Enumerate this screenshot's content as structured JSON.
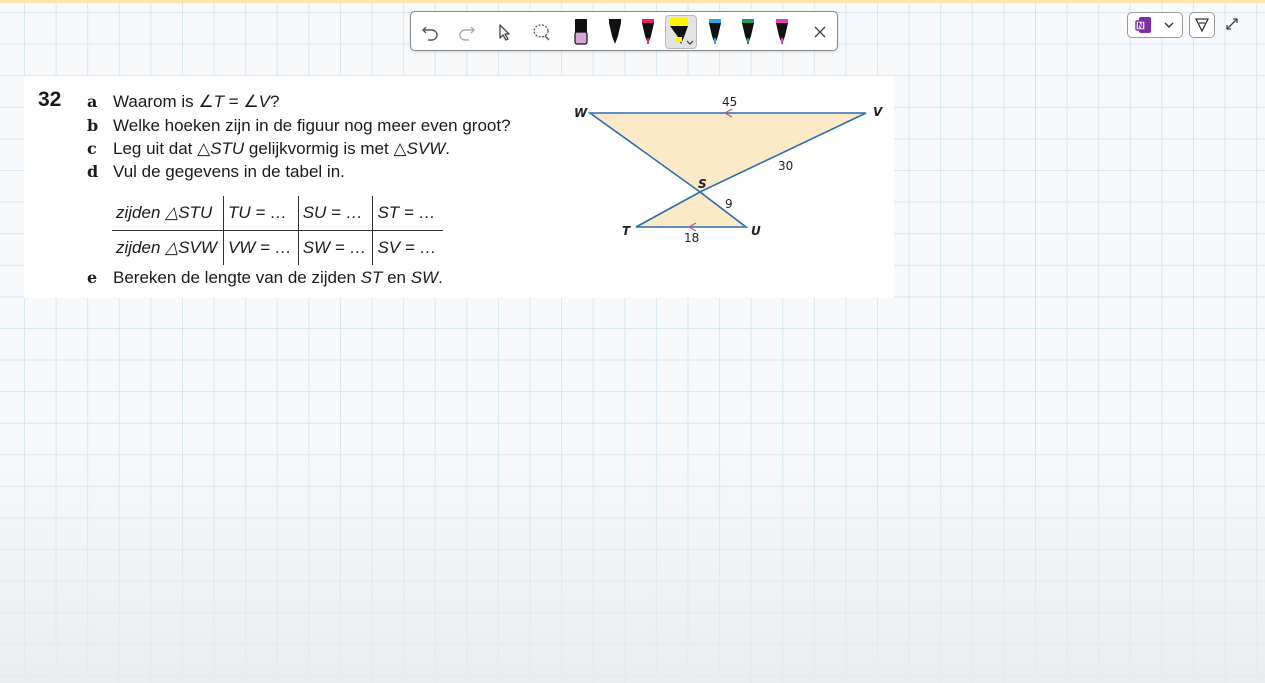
{
  "colors": {
    "accent_stripe": "#fbe3b0",
    "highlight": "#fff200",
    "triangle_fill": "#fce9c8",
    "triangle_stroke": "#2a6ead"
  },
  "toolbar": {
    "undo_icon": "undo-icon",
    "redo_icon": "redo-icon",
    "select_icon": "pointer-icon",
    "lasso_icon": "lasso-icon",
    "pens": [
      {
        "name": "eraser-pen",
        "color": "#d4a6d8"
      },
      {
        "name": "black-pen",
        "color": "#111111"
      },
      {
        "name": "red-pen",
        "color": "#e0245e"
      },
      {
        "name": "yellow-highlighter",
        "color": "#fff200"
      },
      {
        "name": "blue-pen",
        "color": "#2aa7df"
      },
      {
        "name": "green-pen",
        "color": "#1f9e5a"
      },
      {
        "name": "magenta-pen",
        "color": "#e040b0"
      }
    ],
    "close_icon": "close-icon"
  },
  "controls": {
    "onenote_icon": "onenote-icon",
    "dropdown_icon": "chevron-down-icon",
    "pen_icon": "pen-tip-icon",
    "expand_icon": "expand-icon"
  },
  "exercise": {
    "number": "32",
    "questions": {
      "a": {
        "letter": "a",
        "text_before": "Waarom is ∠",
        "t": "T",
        "mid": " = ∠",
        "v": "V",
        "after": "?"
      },
      "b": {
        "letter": "b",
        "text": "Welke hoeken zijn in de figuur nog meer even groot?"
      },
      "c": {
        "letter": "c",
        "text_before": "Leg uit dat △",
        "stu": "STU",
        "mid": " gelijkvormig is met △",
        "svw": "SVW",
        "after": "."
      },
      "d": {
        "letter": "d",
        "text": "Vul de gegevens in de tabel in."
      },
      "e": {
        "letter": "e",
        "text_before": "Bereken de lengte van de zijden ",
        "st": "ST",
        "mid": " en ",
        "sw": "SW",
        "after": "."
      }
    },
    "table": {
      "rows": [
        [
          "zijden △STU",
          "TU = …",
          "SU = …",
          "ST = …"
        ],
        [
          "zijden △SVW",
          "VW = …",
          "SW = …",
          "SV = …"
        ]
      ]
    },
    "figure": {
      "vertices": {
        "W": "W",
        "V": "V",
        "S": "S",
        "T": "T",
        "U": "U"
      },
      "lengths": {
        "WV": "45",
        "SV": "30",
        "SU": "9",
        "TU": "18"
      }
    }
  }
}
